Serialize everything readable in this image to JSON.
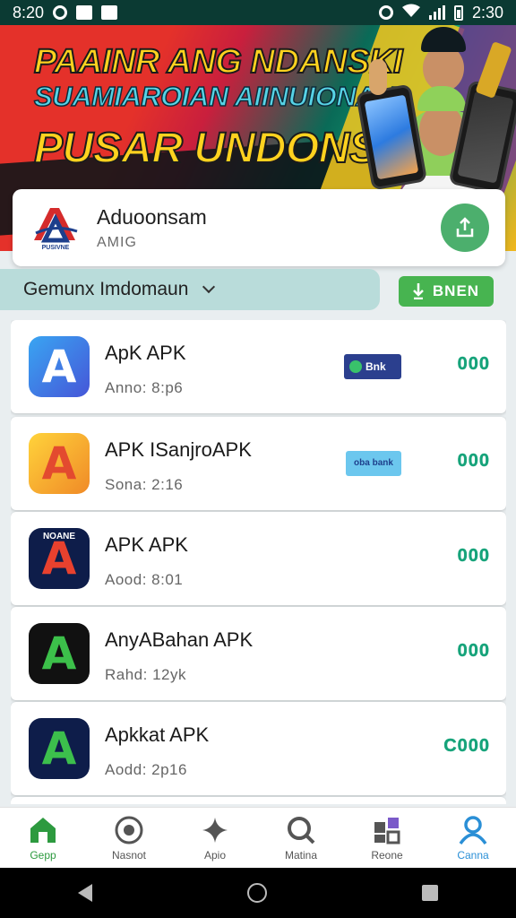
{
  "status_bar": {
    "time_left": "8:20",
    "time_right": "2:30"
  },
  "banner": {
    "line1": "PAAINR ANG NDANSKI",
    "line2": "SUAMIAROIAN AIINUIONAH",
    "line3": "PUSAR UNDONSIA"
  },
  "app_card": {
    "title": "Aduoonsam",
    "subtitle": "AMIG",
    "logo_caption": "PUSIVNE"
  },
  "filter": {
    "label": "Gemunx Imdomaun",
    "button_label": "BNEN"
  },
  "apps": [
    {
      "name": "ApK APK",
      "meta": "Anno: 8:p6",
      "badge": "Bnk",
      "score": "000",
      "icon_colors": [
        "#2f8be8",
        "#4a57d6"
      ]
    },
    {
      "name": "APK ISanjroAPK",
      "meta": "Sona: 2:16",
      "badge": "oba bank",
      "score": "000",
      "icon_colors": [
        "#f6b51f",
        "#e8563a"
      ]
    },
    {
      "name": "APK APK",
      "meta": "Aood: 8:01",
      "badge": "",
      "score": "000",
      "icon_colors": [
        "#0e1d4a",
        "#0e1d4a"
      ],
      "icon_caption": "NOANE"
    },
    {
      "name": "AnyABahan APK",
      "meta": "Rahd: 12yk",
      "badge": "",
      "score": "000",
      "icon_colors": [
        "#111",
        "#111"
      ]
    },
    {
      "name": "Apkkat APK",
      "meta": "Aodd: 2p16",
      "badge": "",
      "score": "C000",
      "icon_colors": [
        "#0e1d4a",
        "#0e1d4a"
      ]
    }
  ],
  "bottom_nav": [
    {
      "label": "Gepp",
      "icon": "home-icon"
    },
    {
      "label": "Nasnot",
      "icon": "camera-icon"
    },
    {
      "label": "Apio",
      "icon": "sparkle-icon"
    },
    {
      "label": "Matina",
      "icon": "search-icon"
    },
    {
      "label": "Reone",
      "icon": "apps-icon"
    },
    {
      "label": "Canna",
      "icon": "profile-icon"
    }
  ],
  "colors": {
    "accent_green": "#47b450",
    "score_green": "#16a37a",
    "active_blue": "#2a8fd6"
  }
}
